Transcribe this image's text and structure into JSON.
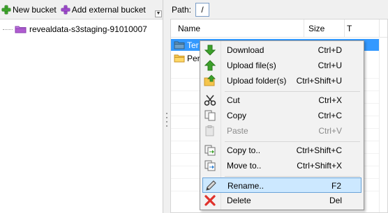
{
  "toolbar": {
    "new_bucket_label": "New bucket",
    "new_bucket_icon": "green-plus-icon",
    "add_external_bucket_label": "Add external bucket",
    "add_external_bucket_icon": "purple-plus-icon"
  },
  "tree": {
    "items": [
      {
        "label": "revealdata-s3staging-91010007",
        "icon": "bucket-icon"
      }
    ]
  },
  "path": {
    "label": "Path:",
    "value": "/"
  },
  "file_list": {
    "columns": [
      "Name",
      "Size",
      "T"
    ],
    "rows": [
      {
        "name": "Ter",
        "icon": "folder-open-icon",
        "selected": true
      },
      {
        "name": "Per",
        "icon": "folder-icon",
        "selected": false
      }
    ]
  },
  "context_menu": {
    "items": [
      {
        "label": "Download",
        "shortcut": "Ctrl+D",
        "icon": "download-icon",
        "enabled": true
      },
      {
        "label": "Upload file(s)",
        "shortcut": "Ctrl+U",
        "icon": "upload-icon",
        "enabled": true
      },
      {
        "label": "Upload folder(s)",
        "shortcut": "Ctrl+Shift+U",
        "icon": "upload-folder-icon",
        "enabled": true
      },
      {
        "label": "Cut",
        "shortcut": "Ctrl+X",
        "icon": "scissors-icon",
        "enabled": true
      },
      {
        "label": "Copy",
        "shortcut": "Ctrl+C",
        "icon": "copy-icon",
        "enabled": true
      },
      {
        "label": "Paste",
        "shortcut": "Ctrl+V",
        "icon": "paste-icon",
        "enabled": false
      },
      {
        "label": "Copy to..",
        "shortcut": "Ctrl+Shift+C",
        "icon": "copy-to-icon",
        "enabled": true
      },
      {
        "label": "Move to..",
        "shortcut": "Ctrl+Shift+X",
        "icon": "move-to-icon",
        "enabled": true
      },
      {
        "label": "Rename..",
        "shortcut": "F2",
        "icon": "rename-pencil-icon",
        "enabled": true,
        "highlighted": true
      },
      {
        "label": "Delete",
        "shortcut": "Del",
        "icon": "delete-x-icon",
        "enabled": true
      }
    ]
  },
  "colors": {
    "selection": "#3399ff",
    "menu_highlight": "#cce8ff",
    "menu_highlight_border": "#6aa3d8",
    "green_arrow": "#3da12b",
    "delete_red": "#e0312b",
    "folder_yellow": "#f5c54c",
    "bucket_purple": "#b05bd0"
  }
}
